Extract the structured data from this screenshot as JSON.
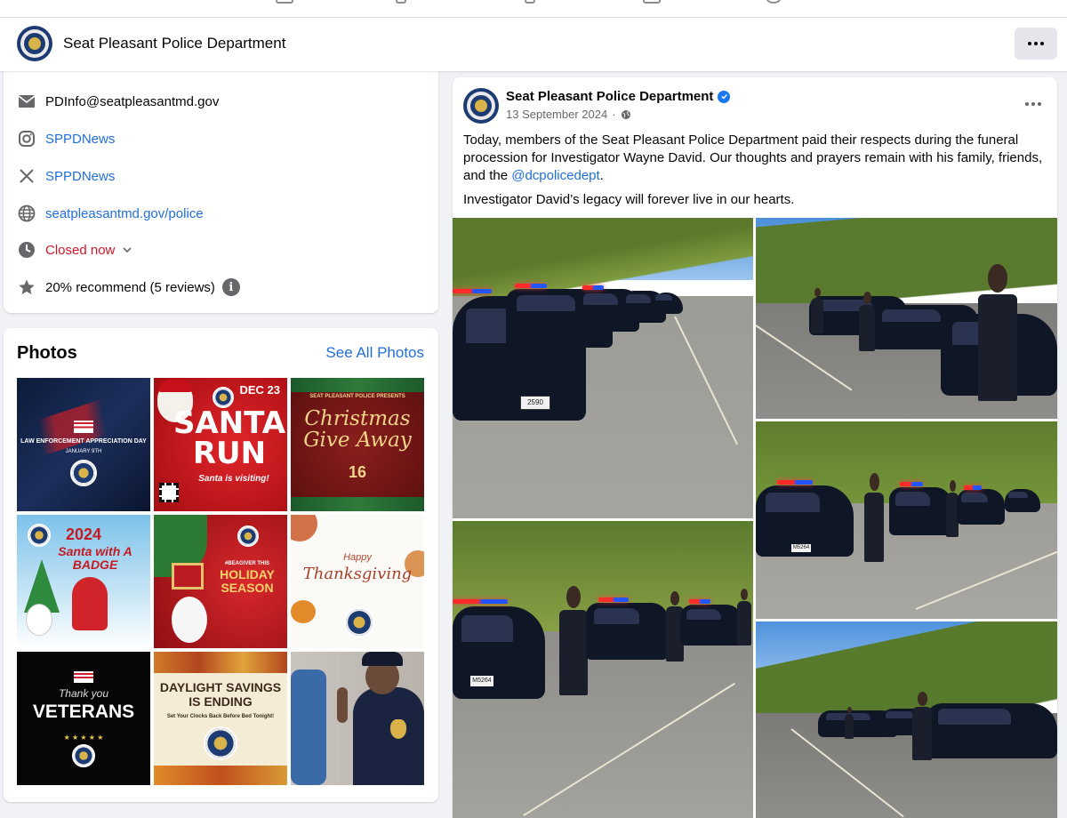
{
  "page": {
    "name": "Seat Pleasant Police Department"
  },
  "intro": {
    "email": "PDInfo@seatpleasantmd.gov",
    "instagram": "SPPDNews",
    "x_handle": "SPPDNews",
    "website": "seatpleasantmd.gov/police",
    "hours_status": "Closed now",
    "recommend": "20% recommend (5 reviews)",
    "info_badge": "i"
  },
  "photos": {
    "title": "Photos",
    "see_all": "See All Photos",
    "tiles": [
      {
        "caption": "LAW ENFORCEMENT APPRECIATION DAY",
        "sub": "JANUARY 9TH"
      },
      {
        "caption": "SANTA RUN",
        "sub": "DEC 23",
        "extra": "Santa is visiting!"
      },
      {
        "caption": "Christmas Give Away",
        "sub": "16",
        "extra": "SEAT PLEASANT POLICE PRESENTS"
      },
      {
        "caption": "Santa with A BADGE",
        "sub": "2024"
      },
      {
        "caption": "HOLIDAY SEASON",
        "sub": "#BEAGIVER THIS"
      },
      {
        "caption": "Thanksgiving",
        "sub": "Happy"
      },
      {
        "caption": "VETERANS",
        "sub": "Thank you"
      },
      {
        "caption": "DAYLIGHT SAVINGS IS ENDING",
        "sub": "Set Your Clocks Back Before Bed Tonight!"
      },
      {
        "caption": "",
        "sub": ""
      }
    ]
  },
  "post": {
    "author": "Seat Pleasant Police Department",
    "date": "13 September 2024",
    "text_1": "Today, members of the Seat Pleasant Police Department paid their respects during the funeral procession for Investigator Wayne David. Our thoughts and prayers remain with his family, friends, and the ",
    "mention": "@dcpolicedept",
    "text_1_end": ".",
    "text_2": "Investigator David’s legacy will forever live in our hearts.",
    "plates": [
      "2590",
      "M5264",
      "M5264"
    ]
  },
  "colors": {
    "link": "#216fdb",
    "closed": "#d3152a",
    "verified": "#1877f2"
  }
}
